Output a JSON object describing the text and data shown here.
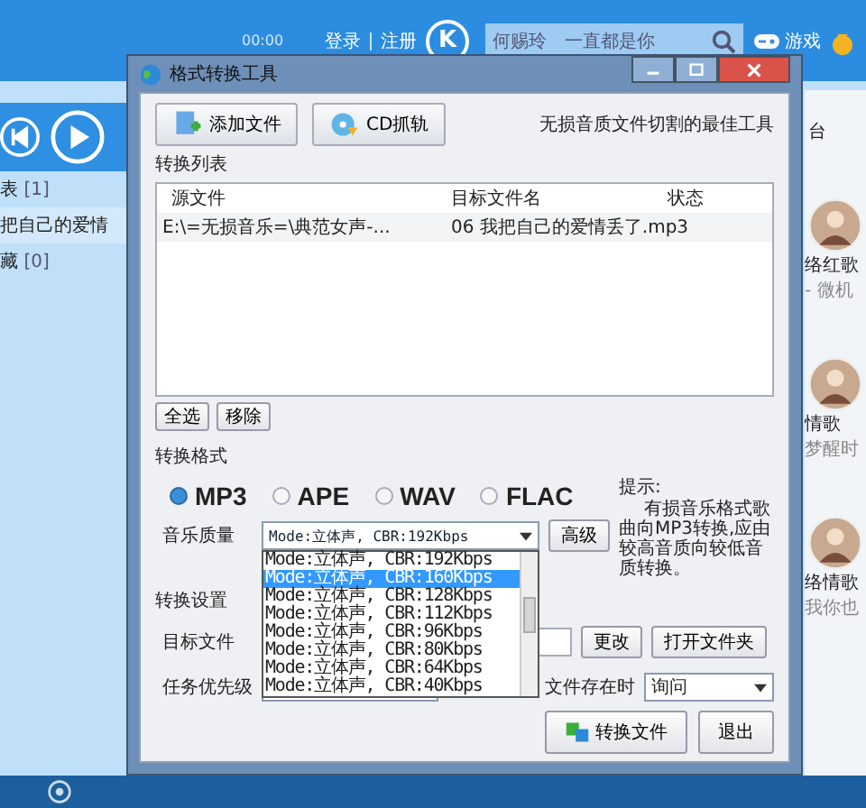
{
  "app": {
    "login": "登录",
    "register": "注册",
    "logo": "K",
    "search": {
      "value": "何赐玲　一直都是你"
    },
    "games": "游戏",
    "time": "00:00",
    "lists": [
      {
        "label": "表",
        "count": "[1]"
      },
      {
        "label": "藏",
        "count": "[0]"
      }
    ],
    "now_playing": "把自己的爱情",
    "right_header": "台",
    "stations": [
      {
        "name": "络红歌",
        "sub": "- 微机"
      },
      {
        "name": "情歌",
        "sub": "梦醒时"
      },
      {
        "name": "络情歌",
        "sub": "我你也"
      }
    ]
  },
  "dialog": {
    "title": "格式转换工具",
    "toolbar": [
      {
        "label": "添加文件",
        "kind": "file"
      },
      {
        "label": "CD抓轨",
        "kind": "cd"
      }
    ],
    "tagline": "无损音质文件切割的最佳工具",
    "list_title": "转换列表",
    "columns": [
      "源文件",
      "目标文件名",
      "状态"
    ],
    "rows": [
      [
        "E:\\=无损音乐=\\典范女声-...",
        "06 我把自己的爱情丢了.mp3",
        ""
      ]
    ],
    "list_buttons": [
      "全选",
      "移除"
    ],
    "format_title": "转换格式",
    "formats": [
      {
        "label": "MP3",
        "selected": true
      },
      {
        "label": "APE",
        "selected": false
      },
      {
        "label": "WAV",
        "selected": false
      },
      {
        "label": "FLAC",
        "selected": false
      }
    ],
    "hint_title": "提示:",
    "hint": "有损音乐格式歌曲向MP3转换,应由较高音质向较低音质转换。",
    "quality_label": "音乐质量",
    "quality": {
      "value": "Mode:立体声, CBR:192Kbps"
    },
    "advanced": "高级",
    "quality_options": [
      {
        "label": "Mode:立体声, CBR:192Kbps",
        "selected": false
      },
      {
        "label": "Mode:立体声, CBR:160Kbps",
        "selected": true
      },
      {
        "label": "Mode:立体声, CBR:128Kbps",
        "selected": false
      },
      {
        "label": "Mode:立体声, CBR:112Kbps",
        "selected": false
      },
      {
        "label": "Mode:立体声, CBR:96Kbps",
        "selected": false
      },
      {
        "label": "Mode:立体声, CBR:80Kbps",
        "selected": false
      },
      {
        "label": "Mode:立体声, CBR:64Kbps",
        "selected": false
      },
      {
        "label": "Mode:立体声, CBR:40Kbps",
        "selected": false
      }
    ],
    "settings_title": "转换设置",
    "folder_label": "目标文件",
    "change": "更改",
    "open_folder": "打开文件夹",
    "priority_label": "任务优先级",
    "exists_label": "文件存在时",
    "exists": {
      "value": "询问"
    },
    "convert": "转换文件",
    "exit": "退出"
  }
}
